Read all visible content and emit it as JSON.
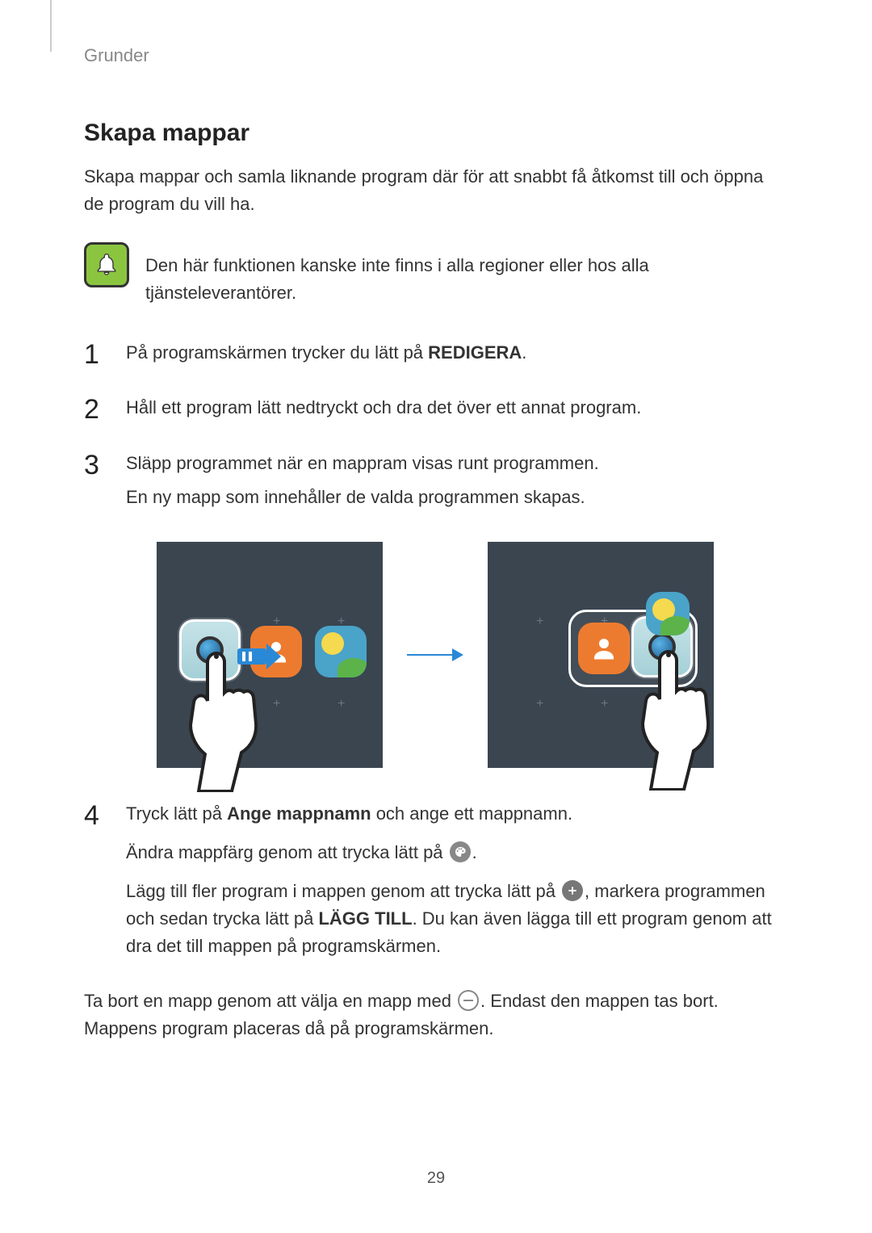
{
  "header": {
    "breadcrumb": "Grunder"
  },
  "section": {
    "title": "Skapa mappar"
  },
  "intro": "Skapa mappar och samla liknande program där för att snabbt få åtkomst till och öppna de program du vill ha.",
  "note": "Den här funktionen kanske inte finns i alla regioner eller hos alla tjänsteleverantörer.",
  "steps": {
    "s1": {
      "num": "1",
      "pre": "På programskärmen trycker du lätt på ",
      "bold": "REDIGERA",
      "post": "."
    },
    "s2": {
      "num": "2",
      "text": "Håll ett program lätt nedtryckt och dra det över ett annat program."
    },
    "s3": {
      "num": "3",
      "line1": "Släpp programmet när en mappram visas runt programmen.",
      "line2": "En ny mapp som innehåller de valda programmen skapas."
    },
    "s4": {
      "num": "4",
      "line1_pre": "Tryck lätt på ",
      "line1_bold": "Ange mappnamn",
      "line1_post": " och ange ett mappnamn.",
      "line2_pre": "Ändra mappfärg genom att trycka lätt på ",
      "line2_post": ".",
      "line3_pre": "Lägg till fler program i mappen genom att trycka lätt på ",
      "line3_mid": ", markera programmen och sedan trycka lätt på ",
      "line3_bold": "LÄGG TILL",
      "line3_post": ". Du kan även lägga till ett program genom att dra det till mappen på programskärmen."
    }
  },
  "trailing": {
    "pre": "Ta bort en mapp genom att välja en mapp med ",
    "post": ". Endast den mappen tas bort. Mappens program placeras då på programskärmen."
  },
  "pageNumber": "29"
}
